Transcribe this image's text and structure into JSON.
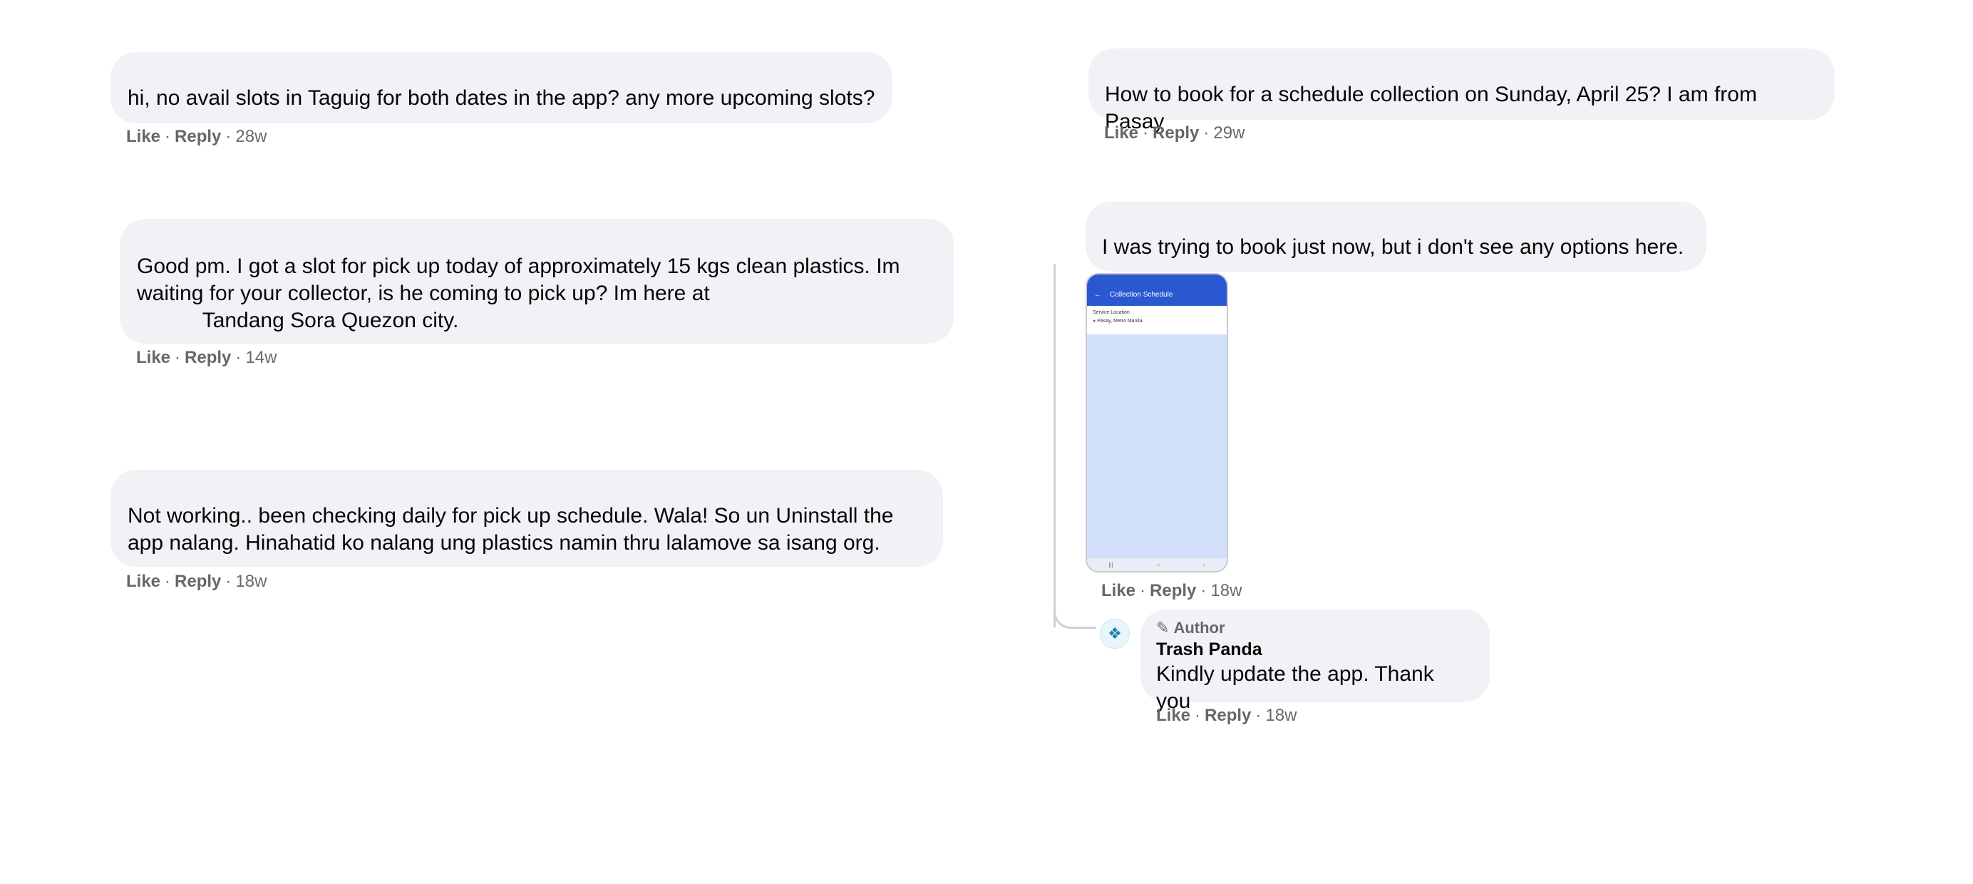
{
  "comments": [
    {
      "text": "hi, no avail slots in Taguig for both dates in the app? any more upcoming slots?",
      "like": "Like",
      "reply": "Reply",
      "time": "28w"
    },
    {
      "text": "Good pm. I got a slot for pick up today of approximately 15 kgs clean plastics. Im waiting for your collector, is he coming to pick up? Im here at\n           Tandang Sora Quezon city.",
      "like": "Like",
      "reply": "Reply",
      "time": "14w"
    },
    {
      "text": "Not working.. been checking daily for pick up schedule. Wala! So un Uninstall the app nalang. Hinahatid ko nalang ung plastics namin thru lalamove sa isang org.",
      "like": "Like",
      "reply": "Reply",
      "time": "18w"
    },
    {
      "text": "How to book for a schedule collection on Sunday, April 25? I am from Pasay",
      "like": "Like",
      "reply": "Reply",
      "time": "29w"
    },
    {
      "text": "I was trying to book just now, but i don't see any options here.",
      "like": "Like",
      "reply": "Reply",
      "time": "18w",
      "attachment": {
        "app_title": "Collection Schedule",
        "section_label": "Service Location",
        "location": "Pasay, Metro Manila"
      }
    }
  ],
  "author_reply": {
    "badge": "Author",
    "name": "Trash Panda",
    "text": "Kindly update the app. Thank you",
    "like": "Like",
    "reply": "Reply",
    "time": "18w"
  },
  "separator": "·",
  "colors": {
    "bubble": "#f0f2f5",
    "meta": "#65676b",
    "app_bar": "#2a58d0"
  },
  "icons": {
    "author_badge": "pencil-icon",
    "avatar": "raccoon-logo"
  }
}
